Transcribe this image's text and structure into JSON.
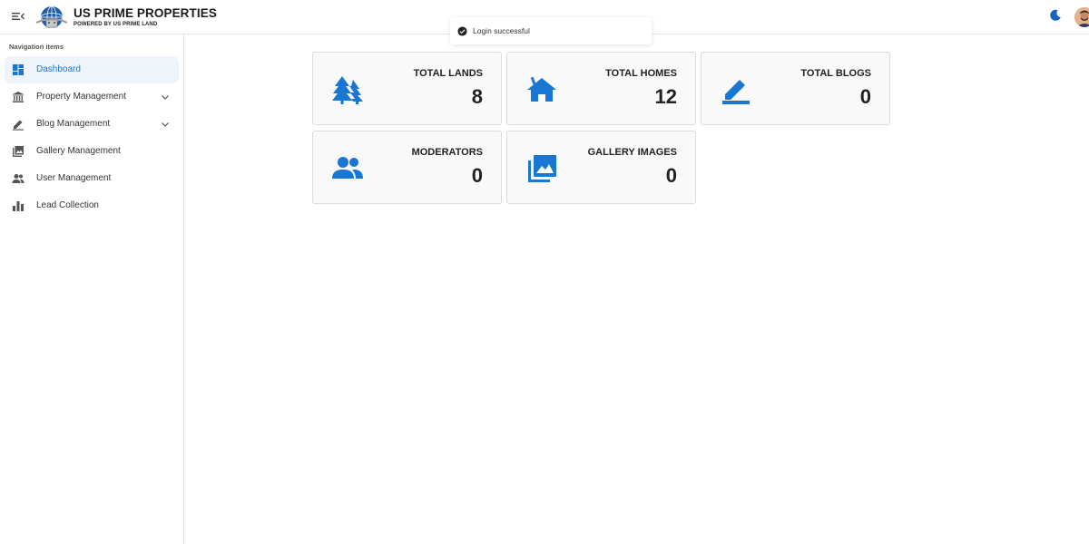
{
  "header": {
    "brand_title": "US PRIME PROPERTIES",
    "brand_subtitle": "POWERED BY US PRIME LAND"
  },
  "toast": {
    "message": "Login successful"
  },
  "sidebar": {
    "heading": "Navigation items",
    "items": [
      {
        "label": "Dashboard",
        "icon": "dashboard-icon",
        "active": true
      },
      {
        "label": "Property Management",
        "icon": "bank-icon",
        "expandable": true
      },
      {
        "label": "Blog Management",
        "icon": "edit-icon",
        "expandable": true
      },
      {
        "label": "Gallery Management",
        "icon": "photo-library-icon"
      },
      {
        "label": "User Management",
        "icon": "people-icon"
      },
      {
        "label": "Lead Collection",
        "icon": "bar-chart-icon"
      }
    ]
  },
  "cards": [
    {
      "title": "TOTAL LANDS",
      "value": "8",
      "icon": "trees-icon"
    },
    {
      "title": "TOTAL HOMES",
      "value": "12",
      "icon": "home-icon"
    },
    {
      "title": "TOTAL BLOGS",
      "value": "0",
      "icon": "edit-icon"
    },
    {
      "title": "MODERATORS",
      "value": "0",
      "icon": "people-icon"
    },
    {
      "title": "GALLERY IMAGES",
      "value": "0",
      "icon": "image-icon"
    }
  ],
  "colors": {
    "accent": "#1976d2",
    "active_bg": "#eef4fa",
    "card_bg": "#f9f9f9"
  }
}
